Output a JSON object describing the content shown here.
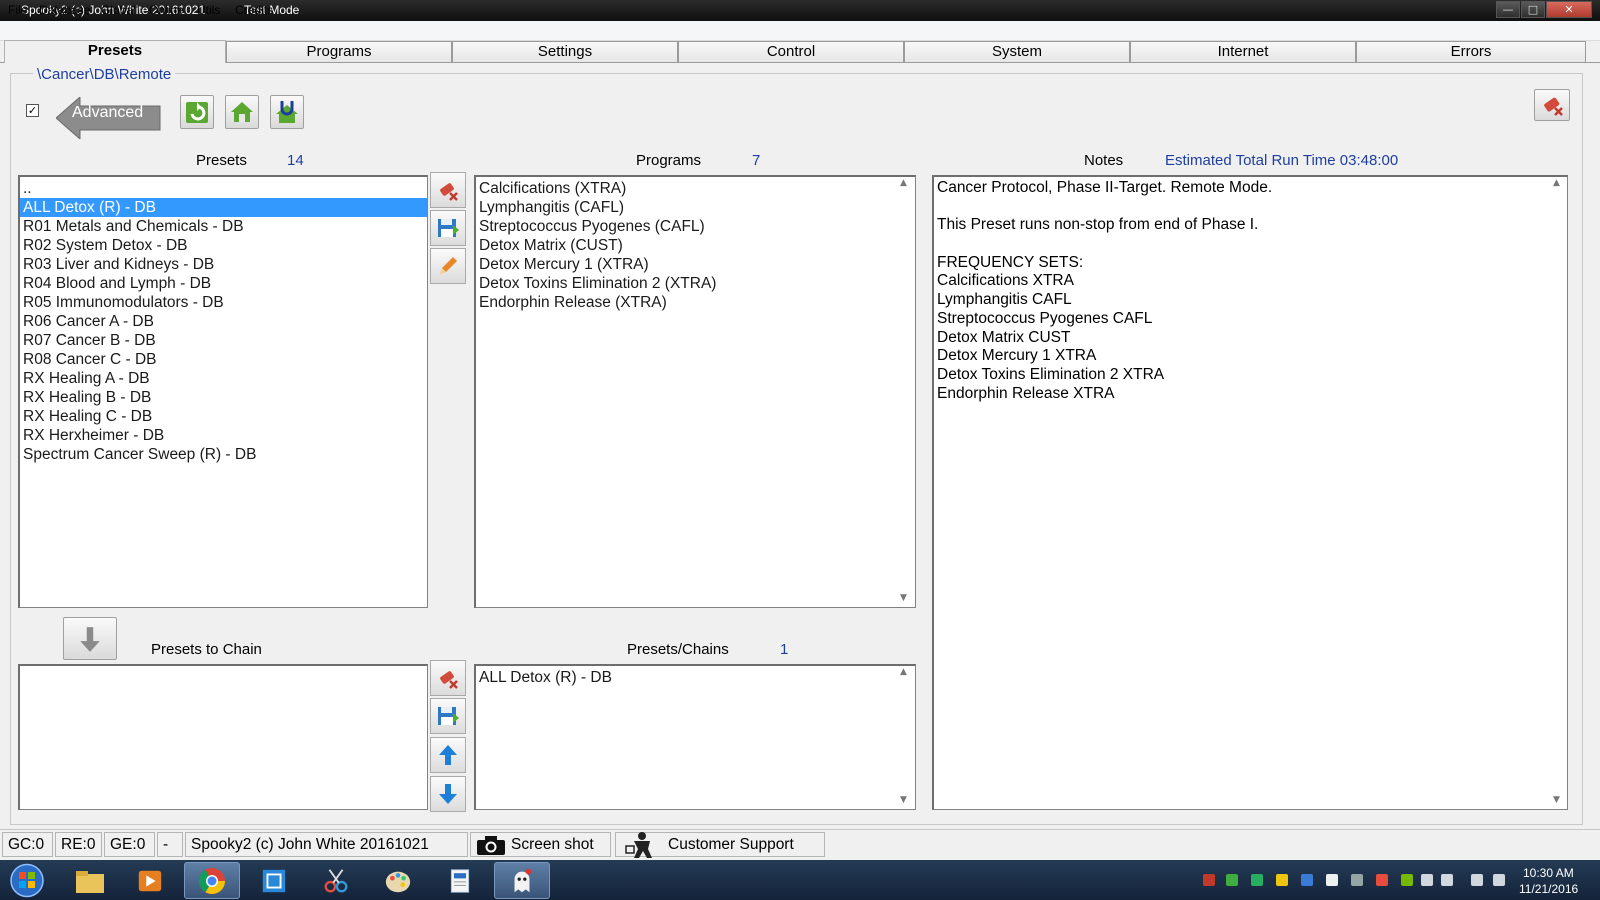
{
  "window": {
    "title": "Spooky2 (c) John White 20161021",
    "mode": "Test Mode",
    "min": "—",
    "max": "□",
    "close": "✕"
  },
  "menu": [
    "File",
    "Database",
    "Global",
    "Online",
    "Utils",
    "Credits"
  ],
  "tabs": [
    "Presets",
    "Programs",
    "Settings",
    "Control",
    "System",
    "Internet",
    "Errors"
  ],
  "active_tab": "Presets",
  "path": "\\Cancer\\DB\\Remote",
  "advanced": {
    "checked": "✓",
    "label": "Advanced"
  },
  "presets": {
    "header": "Presets",
    "count": "14",
    "items": [
      "..",
      "ALL Detox (R) - DB",
      "R01 Metals and Chemicals - DB",
      "R02 System Detox - DB",
      "R03 Liver and Kidneys - DB",
      "R04 Blood and Lymph - DB",
      "R05 Immunomodulators - DB",
      "R06 Cancer A - DB",
      "R07 Cancer B - DB",
      "R08 Cancer C - DB",
      "RX Healing A - DB",
      "RX Healing B - DB",
      "RX Healing C - DB",
      "RX Herxheimer - DB",
      "Spectrum Cancer Sweep (R) - DB"
    ],
    "selected_index": 1
  },
  "programs": {
    "header": "Programs",
    "count": "7",
    "items": [
      "Calcifications (XTRA)",
      "Lymphangitis (CAFL)",
      "Streptococcus Pyogenes (CAFL)",
      "Detox Matrix (CUST)",
      "Detox Mercury 1 (XTRA)",
      "Detox Toxins Elimination 2 (XTRA)",
      "Endorphin Release (XTRA)"
    ]
  },
  "notes": {
    "header": "Notes",
    "run_time": "Estimated Total Run Time 03:48:00",
    "lines": [
      "Cancer Protocol, Phase II-Target. Remote Mode.",
      "",
      "This Preset runs non-stop from end of Phase I.",
      "",
      "FREQUENCY SETS:",
      "Calcifications XTRA",
      "Lymphangitis CAFL",
      "Streptococcus Pyogenes CAFL",
      "Detox Matrix CUST",
      "Detox Mercury 1 XTRA",
      "Detox Toxins Elimination 2 XTRA",
      "Endorphin Release XTRA"
    ]
  },
  "chain": {
    "header": "Presets to Chain",
    "items": []
  },
  "presets_chains": {
    "header": "Presets/Chains",
    "count": "1",
    "items": [
      "ALL Detox (R) - DB"
    ]
  },
  "scroll": {
    "up": "▲",
    "down": "▼"
  },
  "status": {
    "gc": "GC:0",
    "re": "RE:0",
    "ge": "GE:0",
    "dash": "-",
    "app": "Spooky2 (c) John White 20161021",
    "screenshot": "Screen shot",
    "support": "Customer Support"
  },
  "taskbar": {
    "time": "10:30 AM",
    "date": "11/21/2016"
  },
  "colors": {
    "accent_blue": "#1f3fa0",
    "selection": "#3399ff",
    "icon_green": "#4caf2a"
  }
}
